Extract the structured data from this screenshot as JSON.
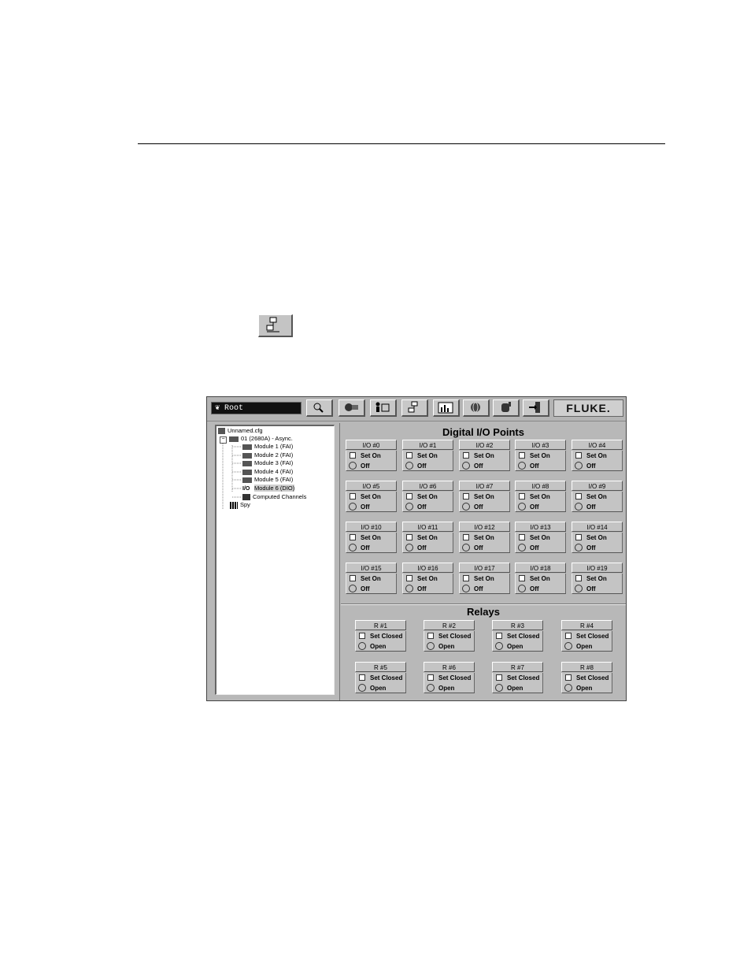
{
  "toolbar": {
    "root_label": "Root",
    "buttons": [
      "search-icon",
      "tools-icon",
      "people-icon",
      "network-icon",
      "chart-icon",
      "globe-icon",
      "hand-icon",
      "exit-icon"
    ],
    "brand": "FLUKE."
  },
  "tree": {
    "items": [
      {
        "label": "Unnamed.cfg"
      },
      {
        "label": "01 (2680A) - Async."
      },
      {
        "label": "Module 1 (FAI)"
      },
      {
        "label": "Module 2 (FAI)"
      },
      {
        "label": "Module 3 (FAI)"
      },
      {
        "label": "Module 4 (FAI)"
      },
      {
        "label": "Module 5 (FAI)"
      },
      {
        "label": "Module 6 (DIO)",
        "prefix": "I/O"
      },
      {
        "label": "Computed Channels"
      },
      {
        "label": "Spy"
      }
    ]
  },
  "digital": {
    "title": "Digital I/O Points",
    "points": [
      {
        "name": "I/O #0",
        "set": "Set On",
        "state": "Off"
      },
      {
        "name": "I/O #1",
        "set": "Set On",
        "state": "Off"
      },
      {
        "name": "I/O #2",
        "set": "Set On",
        "state": "Off"
      },
      {
        "name": "I/O #3",
        "set": "Set On",
        "state": "Off"
      },
      {
        "name": "I/O #4",
        "set": "Set On",
        "state": "Off"
      },
      {
        "name": "I/O #5",
        "set": "Set On",
        "state": "Off"
      },
      {
        "name": "I/O #6",
        "set": "Set On",
        "state": "Off"
      },
      {
        "name": "I/O #7",
        "set": "Set On",
        "state": "Off"
      },
      {
        "name": "I/O #8",
        "set": "Set On",
        "state": "Off"
      },
      {
        "name": "I/O #9",
        "set": "Set On",
        "state": "Off"
      },
      {
        "name": "I/O #10",
        "set": "Set On",
        "state": "Off"
      },
      {
        "name": "I/O #11",
        "set": "Set On",
        "state": "Off"
      },
      {
        "name": "I/O #12",
        "set": "Set On",
        "state": "Off"
      },
      {
        "name": "I/O #13",
        "set": "Set On",
        "state": "Off"
      },
      {
        "name": "I/O #14",
        "set": "Set On",
        "state": "Off"
      },
      {
        "name": "I/O #15",
        "set": "Set On",
        "state": "Off"
      },
      {
        "name": "I/O #16",
        "set": "Set On",
        "state": "Off"
      },
      {
        "name": "I/O #17",
        "set": "Set On",
        "state": "Off"
      },
      {
        "name": "I/O #18",
        "set": "Set On",
        "state": "Off"
      },
      {
        "name": "I/O #19",
        "set": "Set On",
        "state": "Off"
      }
    ]
  },
  "relays": {
    "title": "Relays",
    "items": [
      {
        "name": "R #1",
        "set": "Set Closed",
        "state": "Open"
      },
      {
        "name": "R #2",
        "set": "Set Closed",
        "state": "Open"
      },
      {
        "name": "R #3",
        "set": "Set Closed",
        "state": "Open"
      },
      {
        "name": "R #4",
        "set": "Set Closed",
        "state": "Open"
      },
      {
        "name": "R #5",
        "set": "Set Closed",
        "state": "Open"
      },
      {
        "name": "R #6",
        "set": "Set Closed",
        "state": "Open"
      },
      {
        "name": "R #7",
        "set": "Set Closed",
        "state": "Open"
      },
      {
        "name": "R #8",
        "set": "Set Closed",
        "state": "Open"
      }
    ]
  }
}
